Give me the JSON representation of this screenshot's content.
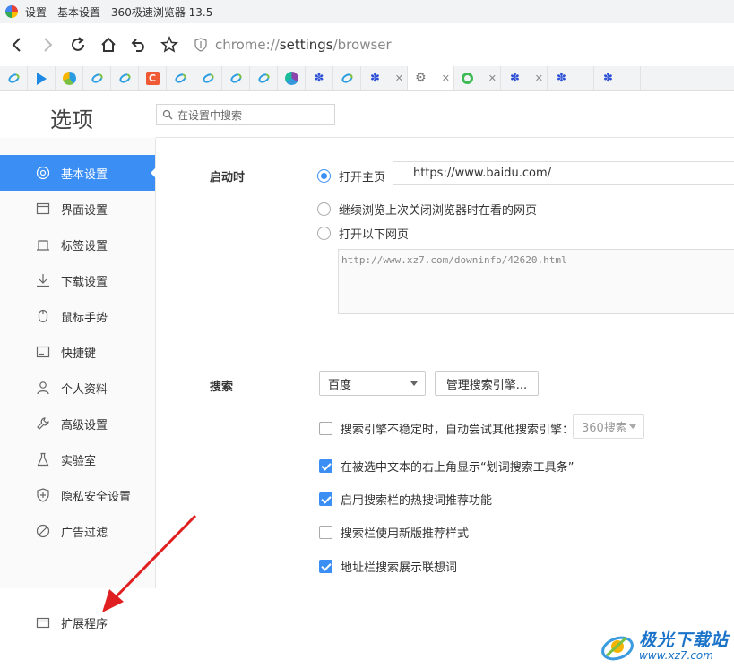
{
  "window": {
    "title": "设置 - 基本设置 - 360极速浏览器 13.5"
  },
  "nav": {
    "url_scheme": "chrome://",
    "url_host": "settings",
    "url_path": "/browser"
  },
  "tabs": [
    {
      "icon": "ie-e-icon"
    },
    {
      "icon": "play-icon"
    },
    {
      "icon": "browser-ball-icon"
    },
    {
      "icon": "ie-e-icon"
    },
    {
      "icon": "ie-e-icon"
    },
    {
      "icon": "c-logo-icon"
    },
    {
      "icon": "ie-e-icon"
    },
    {
      "icon": "ie-e-icon"
    },
    {
      "icon": "ie-e-icon"
    },
    {
      "icon": "ie-e-icon"
    },
    {
      "icon": "360-logo-icon"
    },
    {
      "icon": "baidu-paw-icon"
    },
    {
      "icon": "ie-e-icon"
    },
    {
      "icon": "baidu-paw-icon"
    },
    {
      "icon": "gear-icon"
    },
    {
      "icon": "q-circle-icon"
    },
    {
      "icon": "baidu-paw-icon"
    },
    {
      "icon": "baidu-paw-icon"
    },
    {
      "icon": "baidu-paw-icon"
    },
    {
      "icon": "baidu-paw-icon"
    }
  ],
  "page": {
    "title": "选项",
    "search_placeholder": "在设置中搜索"
  },
  "sidebar": {
    "items": [
      {
        "label": "基本设置",
        "icon": "gear-circle-icon",
        "active": true
      },
      {
        "label": "界面设置",
        "icon": "window-icon"
      },
      {
        "label": "标签设置",
        "icon": "tab-icon"
      },
      {
        "label": "下载设置",
        "icon": "download-icon"
      },
      {
        "label": "鼠标手势",
        "icon": "mouse-icon"
      },
      {
        "label": "快捷键",
        "icon": "keyboard-icon"
      },
      {
        "label": "个人资料",
        "icon": "person-icon"
      },
      {
        "label": "高级设置",
        "icon": "wrench-icon"
      },
      {
        "label": "实验室",
        "icon": "flask-icon"
      },
      {
        "label": "隐私安全设置",
        "icon": "shield-plus-icon"
      },
      {
        "label": "广告过滤",
        "icon": "ban-icon"
      },
      {
        "label": "扩展程序",
        "icon": "extension-icon"
      }
    ]
  },
  "startup": {
    "label": "启动时",
    "opt_homepage": "打开主页",
    "homepage_url": "https://www.baidu.com/",
    "opt_continue": "继续浏览上次关闭浏览器时在看的网页",
    "opt_pages": "打开以下网页",
    "pages_text": "http://www.xz7.com/downinfo/42620.html",
    "selected": "homepage"
  },
  "search": {
    "label": "搜索",
    "engine_value": "百度",
    "manage_button": "管理搜索引擎...",
    "fallback_label": "搜索引擎不稳定时，自动尝试其他搜索引擎：",
    "fallback_value": "360搜索",
    "opt_show_toolbar": "在被选中文本的右上角显示“划词搜索工具条”",
    "opt_hot_words": "启用搜索栏的热搜词推荐功能",
    "opt_new_style": "搜索栏使用新版推荐样式",
    "opt_address_suggest": "地址栏搜索展示联想词",
    "checked": {
      "fallback": false,
      "show_toolbar": true,
      "hot_words": true,
      "new_style": false,
      "address_suggest": true
    }
  },
  "watermark": {
    "cn": "极光下载站",
    "url": "www.xz7.com"
  },
  "colors": {
    "accent": "#3b8ff4",
    "annotation_arrow": "#e02020"
  }
}
